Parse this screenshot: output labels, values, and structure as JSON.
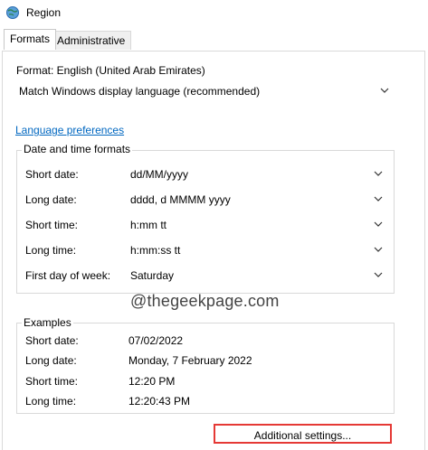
{
  "window": {
    "title": "Region"
  },
  "tabs": [
    {
      "label": "Formats",
      "active": true
    },
    {
      "label": "Administrative",
      "active": false
    }
  ],
  "format": {
    "label": "Format: English (United Arab Emirates)",
    "value": "Match Windows display language (recommended)"
  },
  "language_link": "Language preferences",
  "date_time": {
    "title": "Date and time formats",
    "rows": [
      {
        "label": "Short date:",
        "value": "dd/MM/yyyy"
      },
      {
        "label": "Long date:",
        "value": "dddd, d MMMM yyyy"
      },
      {
        "label": "Short time:",
        "value": "h:mm tt"
      },
      {
        "label": "Long time:",
        "value": "h:mm:ss tt"
      },
      {
        "label": "First day of week:",
        "value": "Saturday"
      }
    ]
  },
  "watermark": "@thegeekpage.com",
  "examples": {
    "title": "Examples",
    "rows": [
      {
        "label": "Short date:",
        "value": "07/02/2022"
      },
      {
        "label": "Long date:",
        "value": "Monday, 7 February 2022"
      },
      {
        "label": "Short time:",
        "value": "12:20 PM"
      },
      {
        "label": "Long time:",
        "value": "12:20:43 PM"
      }
    ]
  },
  "additional_settings_label": "Additional settings...",
  "colors": {
    "link": "#0067c0",
    "highlight": "#e53935",
    "border": "#d9d9d9"
  }
}
